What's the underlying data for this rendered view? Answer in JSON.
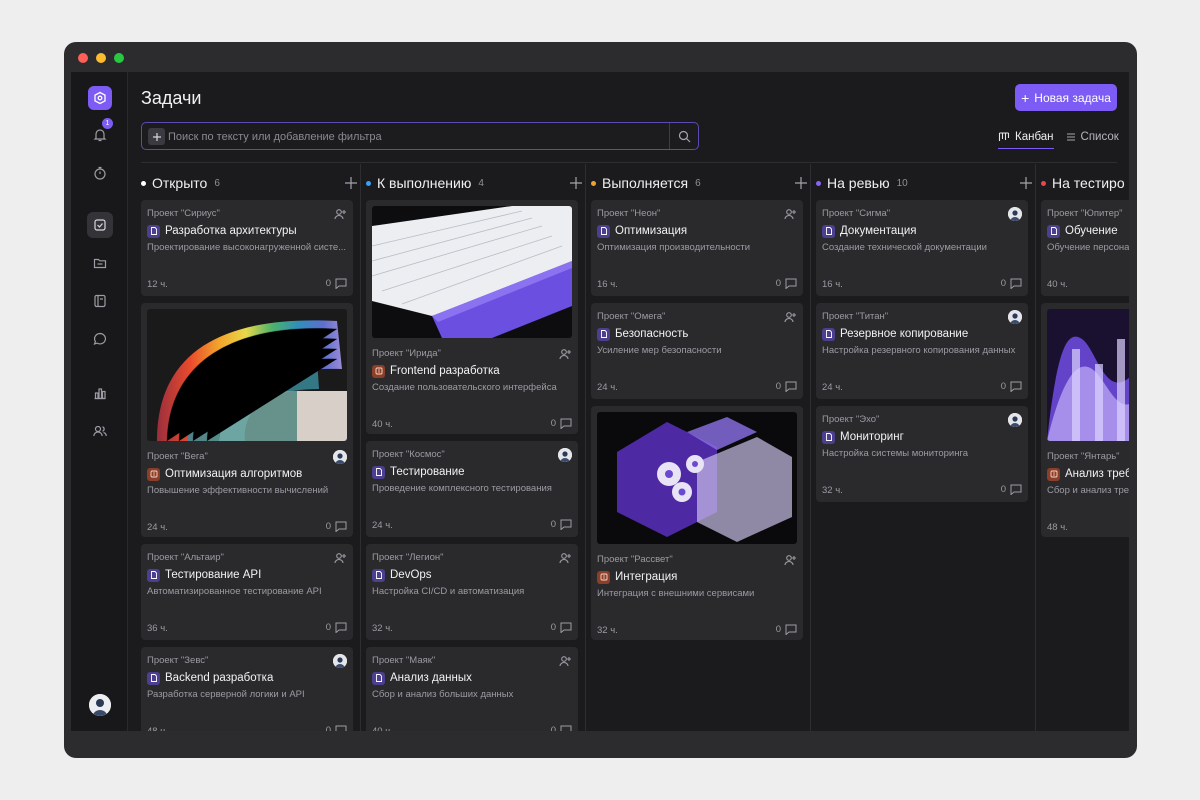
{
  "page": {
    "title": "Задачи",
    "new_task_label": "Новая задача",
    "search_placeholder": "Поиск по тексту или добавление фильтра",
    "notification_count": "1",
    "views": [
      {
        "label": "Канбан",
        "active": true
      },
      {
        "label": "Список",
        "active": false
      }
    ]
  },
  "columns": [
    {
      "name": "Открыто",
      "count": "6",
      "color": "#ffffff",
      "cards": [
        {
          "project": "Проект \"Сириус\"",
          "title": "Разработка архитектуры",
          "desc": "Проектирование высоконагруженной систе...",
          "hours": "12 ч.",
          "comments": "0",
          "icon": "doc-icon",
          "assignee": "add-user-icon"
        },
        {
          "project": "Проект \"Вега\"",
          "title": "Оптимизация алгоритмов",
          "desc": "Повышение эффективности вычислений",
          "hours": "24 ч.",
          "comments": "0",
          "icon": "code-icon",
          "assignee": "avatar",
          "image": "rainbow-paper"
        },
        {
          "project": "Проект \"Альтаир\"",
          "title": "Тестирование API",
          "desc": "Автоматизированное тестирование API",
          "hours": "36 ч.",
          "comments": "0",
          "icon": "doc-icon",
          "assignee": "add-user-icon"
        },
        {
          "project": "Проект \"Зевс\"",
          "title": "Backend разработка",
          "desc": "Разработка серверной логики и API",
          "hours": "48 ч.",
          "comments": "0",
          "icon": "doc-icon",
          "assignee": "avatar"
        }
      ]
    },
    {
      "name": "К выполнению",
      "count": "4",
      "color": "#3aa0f0",
      "cards": [
        {
          "project": "Проект \"Ирида\"",
          "title": "Frontend разработка",
          "desc": "Создание пользовательского интерфейса",
          "hours": "40 ч.",
          "comments": "0",
          "icon": "code-icon",
          "assignee": "add-user-icon",
          "image": "purple-book"
        },
        {
          "project": "Проект \"Космос\"",
          "title": "Тестирование",
          "desc": "Проведение комплексного тестирования",
          "hours": "24 ч.",
          "comments": "0",
          "icon": "doc-icon",
          "assignee": "avatar"
        },
        {
          "project": "Проект \"Легион\"",
          "title": "DevOps",
          "desc": "Настройка CI/CD и автоматизация",
          "hours": "32 ч.",
          "comments": "0",
          "icon": "doc-icon",
          "assignee": "add-user-icon"
        },
        {
          "project": "Проект \"Маяк\"",
          "title": "Анализ данных",
          "desc": "Сбор и анализ больших данных",
          "hours": "40 ч.",
          "comments": "0",
          "icon": "doc-icon",
          "assignee": "add-user-icon"
        }
      ]
    },
    {
      "name": "Выполняется",
      "count": "6",
      "color": "#f0a030",
      "cards": [
        {
          "project": "Проект \"Неон\"",
          "title": "Оптимизация",
          "desc": "Оптимизация производительности",
          "hours": "16 ч.",
          "comments": "0",
          "icon": "doc-icon",
          "assignee": "add-user-icon"
        },
        {
          "project": "Проект \"Омега\"",
          "title": "Безопасность",
          "desc": "Усиление мер безопасности",
          "hours": "24 ч.",
          "comments": "0",
          "icon": "doc-icon",
          "assignee": "add-user-icon"
        },
        {
          "project": "Проект \"Рассвет\"",
          "title": "Интеграция",
          "desc": "Интеграция с внешними сервисами",
          "hours": "32 ч.",
          "comments": "0",
          "icon": "code-icon",
          "assignee": "add-user-icon",
          "image": "glass-gears"
        }
      ]
    },
    {
      "name": "На ревью",
      "count": "10",
      "color": "#8a63f5",
      "cards": [
        {
          "project": "Проект \"Сигма\"",
          "title": "Документация",
          "desc": "Создание технической документации",
          "hours": "16 ч.",
          "comments": "0",
          "icon": "doc-icon",
          "assignee": "avatar"
        },
        {
          "project": "Проект \"Титан\"",
          "title": "Резервное копирование",
          "desc": "Настройка резервного копирования данных",
          "hours": "24 ч.",
          "comments": "0",
          "icon": "doc-icon",
          "assignee": "avatar"
        },
        {
          "project": "Проект \"Эхо\"",
          "title": "Мониторинг",
          "desc": "Настройка системы мониторинга",
          "hours": "32 ч.",
          "comments": "0",
          "icon": "doc-icon",
          "assignee": "avatar"
        }
      ]
    },
    {
      "name": "На тестиро",
      "count": "",
      "color": "#e8454f",
      "cards": [
        {
          "project": "Проект \"Юпитер\"",
          "title": "Обучение",
          "desc": "Обучение персона",
          "hours": "40 ч.",
          "comments": "",
          "icon": "doc-icon",
          "assignee": ""
        },
        {
          "project": "Проект \"Янтарь\"",
          "title": "Анализ треб",
          "desc": "Сбор и анализ тре",
          "hours": "48 ч.",
          "comments": "",
          "icon": "code-icon",
          "assignee": "",
          "image": "glass-bars"
        }
      ]
    }
  ]
}
